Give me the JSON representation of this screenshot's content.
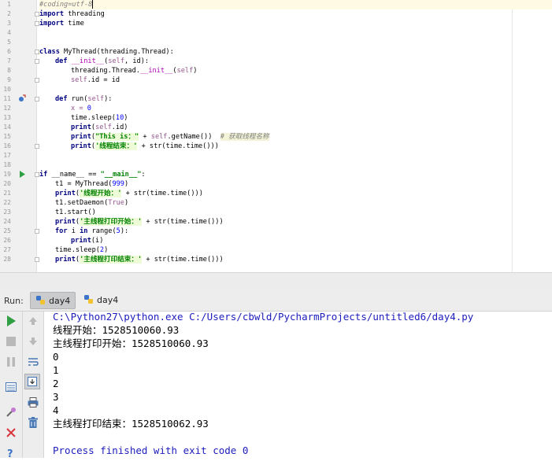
{
  "editor": {
    "line_numbers": [
      "1",
      "2",
      "3",
      "4",
      "5",
      "6",
      "7",
      "8",
      "9",
      "10",
      "11",
      "12",
      "13",
      "14",
      "15",
      "16",
      "17",
      "18",
      "19",
      "20",
      "21",
      "22",
      "23",
      "24",
      "25",
      "26",
      "27",
      "28"
    ],
    "code": {
      "l1": "#coding=utf-8",
      "l2_kw": "import",
      "l2_rest": " threading",
      "l3_kw": "import",
      "l3_rest": " time",
      "l6_kw": "class",
      "l6_rest": " MyThread(threading.Thread):",
      "l7_kw": "def",
      "l7_name": " __init__",
      "l7_open": "(",
      "l7_self": "self",
      "l7_rest": ", id):",
      "l8_a": "threading.Thread.",
      "l8_d": "__init__",
      "l8_b": "(",
      "l8_self": "self",
      "l8_c": ")",
      "l9_self": "self",
      "l9_rest": ".id = id",
      "l11_kw": "def",
      "l11_rest": " run(",
      "l11_self": "self",
      "l11_end": "):",
      "l12_x": "x = ",
      "l12_num": "0",
      "l13_a": "time.sleep(",
      "l13_num": "10",
      "l13_b": ")",
      "l14_kw": "print",
      "l14_a": "(",
      "l14_self": "self",
      "l14_b": ".id)",
      "l15_kw": "print",
      "l15_a": "(",
      "l15_str": "\"This is：\"",
      "l15_b": " + ",
      "l15_self": "self",
      "l15_c": ".getName())  ",
      "l15_cmt": "# 获取线程名称",
      "l16_kw": "print",
      "l16_a": "(",
      "l16_str": "'线程结束：'",
      "l16_b": " + str(time.time()))",
      "l19_kw": "if",
      "l19_a": " __name__ == ",
      "l19_str": "\"__main__\"",
      "l19_b": ":",
      "l20_a": "t1 = MyThread(",
      "l20_num": "999",
      "l20_b": ")",
      "l21_kw": "print",
      "l21_a": "(",
      "l21_str": "'线程开始：'",
      "l21_b": " + str(time.time()))",
      "l22_a": "t1.setDaemon(",
      "l22_val": "True",
      "l22_b": ")",
      "l23": "t1.start()",
      "l24_kw": "print",
      "l24_a": "(",
      "l24_str": "'主线程打印开始：'",
      "l24_b": " + str(time.time()))",
      "l25_kw": "for",
      "l25_a": " i ",
      "l25_kw2": "in",
      "l25_b": " range(",
      "l25_num": "5",
      "l25_c": "):",
      "l26_kw": "print",
      "l26_a": "(i)",
      "l27_a": "time.sleep(",
      "l27_num": "2",
      "l27_b": ")",
      "l28_kw": "print",
      "l28_a": "(",
      "l28_str": "'主线程打印结束：'",
      "l28_b": " + str(time.time()))"
    }
  },
  "run_panel": {
    "label": "Run:",
    "tabs": [
      {
        "label": "day4"
      },
      {
        "label": "day4"
      }
    ]
  },
  "console": {
    "lines": [
      "C:\\Python27\\python.exe C:/Users/cbwld/PycharmProjects/untitled6/day4.py",
      "线程开始：1528510060.93",
      "主线程打印开始：1528510060.93",
      "0",
      "1",
      "2",
      "3",
      "4",
      "主线程打印结束：1528510062.93",
      "",
      "Process finished with exit code 0"
    ]
  },
  "colors": {
    "keyword": "#000080",
    "string": "#008000",
    "number": "#0000ff",
    "self": "#94558d",
    "comment": "#808080",
    "console_command": "#1c1cbd",
    "run_green": "#2ea043",
    "stop_red": "#d9363e"
  },
  "icons": {
    "toolbar1": [
      "run-icon",
      "stop-icon",
      "pause-icon",
      "dump-threads-icon",
      "settings-icon",
      "close-icon",
      "help-icon"
    ],
    "toolbar2": [
      "scroll-up-icon",
      "scroll-down-icon",
      "soft-wrap-icon",
      "scroll-to-end-icon",
      "print-icon",
      "trash-icon"
    ]
  }
}
